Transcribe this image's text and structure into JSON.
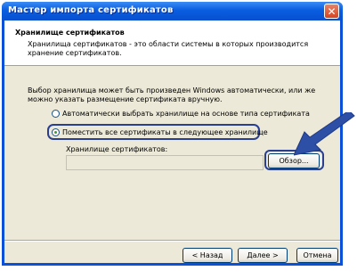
{
  "window": {
    "title": "Мастер импорта сертификатов",
    "close_glyph": "✕"
  },
  "header": {
    "title": "Хранилище сертификатов",
    "description": "Хранилища сертификатов - это области системы в которых производится хранение сертификатов."
  },
  "body": {
    "intro": "Выбор хранилища может быть произведен Windows автоматически, или же можно указать размещение сертификата вручную.",
    "radio_auto": {
      "label": "Автоматически выбрать хранилище на основе типа сертификата",
      "checked": false
    },
    "radio_manual": {
      "label": "Поместить все сертификаты в следующее хранилище",
      "checked": true
    },
    "store_label": "Хранилище сертификатов:",
    "store_value": "",
    "browse_label": "Обзор..."
  },
  "footer": {
    "back_label": "< Назад",
    "next_label": "Далее >",
    "cancel_label": "Отмена"
  },
  "colors": {
    "titlebar": "#0a5ee0",
    "client_bg": "#ece9d8",
    "highlight_border": "#2a3f8f",
    "annotation_arrow": "#2e4fa6"
  },
  "icons": {
    "annotation": "arrow-pointer-icon",
    "close": "close-icon"
  }
}
